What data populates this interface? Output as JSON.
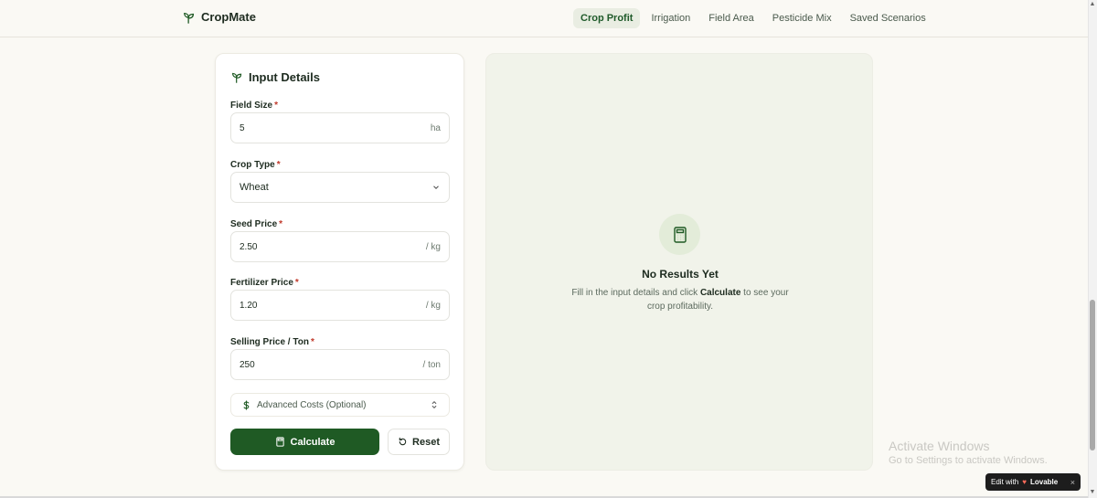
{
  "brand": {
    "name_a": "Crop",
    "name_b": "Mate",
    "icon": "sprout-icon"
  },
  "nav": {
    "tabs": [
      "Crop Profit",
      "Irrigation",
      "Field Area",
      "Pesticide Mix",
      "Saved Scenarios"
    ],
    "active": "Crop Profit"
  },
  "form": {
    "title": "Input Details",
    "required_mark": "*",
    "field_size": {
      "label": "Field Size",
      "value": "5",
      "unit": "ha"
    },
    "crop_type": {
      "label": "Crop Type",
      "value": "Wheat"
    },
    "seed_price": {
      "label": "Seed Price",
      "value": "2.50",
      "unit": "/ kg"
    },
    "fertilizer_price": {
      "label": "Fertilizer Price",
      "value": "1.20",
      "unit": "/ kg"
    },
    "selling_price": {
      "label": "Selling Price / Ton",
      "value": "250",
      "unit": "/ ton"
    },
    "advanced": {
      "label": "Advanced Costs (Optional)",
      "icon": "dollar-icon"
    },
    "calculate_label": "Calculate",
    "reset_label": "Reset"
  },
  "results": {
    "title": "No Results Yet",
    "desc_before": "Fill in the input details and click ",
    "desc_bold": "Calculate",
    "desc_after": " to see your crop profitability."
  },
  "os": {
    "activate_title": "Activate Windows",
    "activate_sub": "Go to Settings to activate Windows.",
    "badge_prefix": "Edit with",
    "badge_brand": "Lovable",
    "badge_close": "×"
  },
  "colors": {
    "primary": "#1f5a24",
    "background": "#faf9f4",
    "results_bg": "#f1f3ea",
    "required": "#c0392b"
  }
}
